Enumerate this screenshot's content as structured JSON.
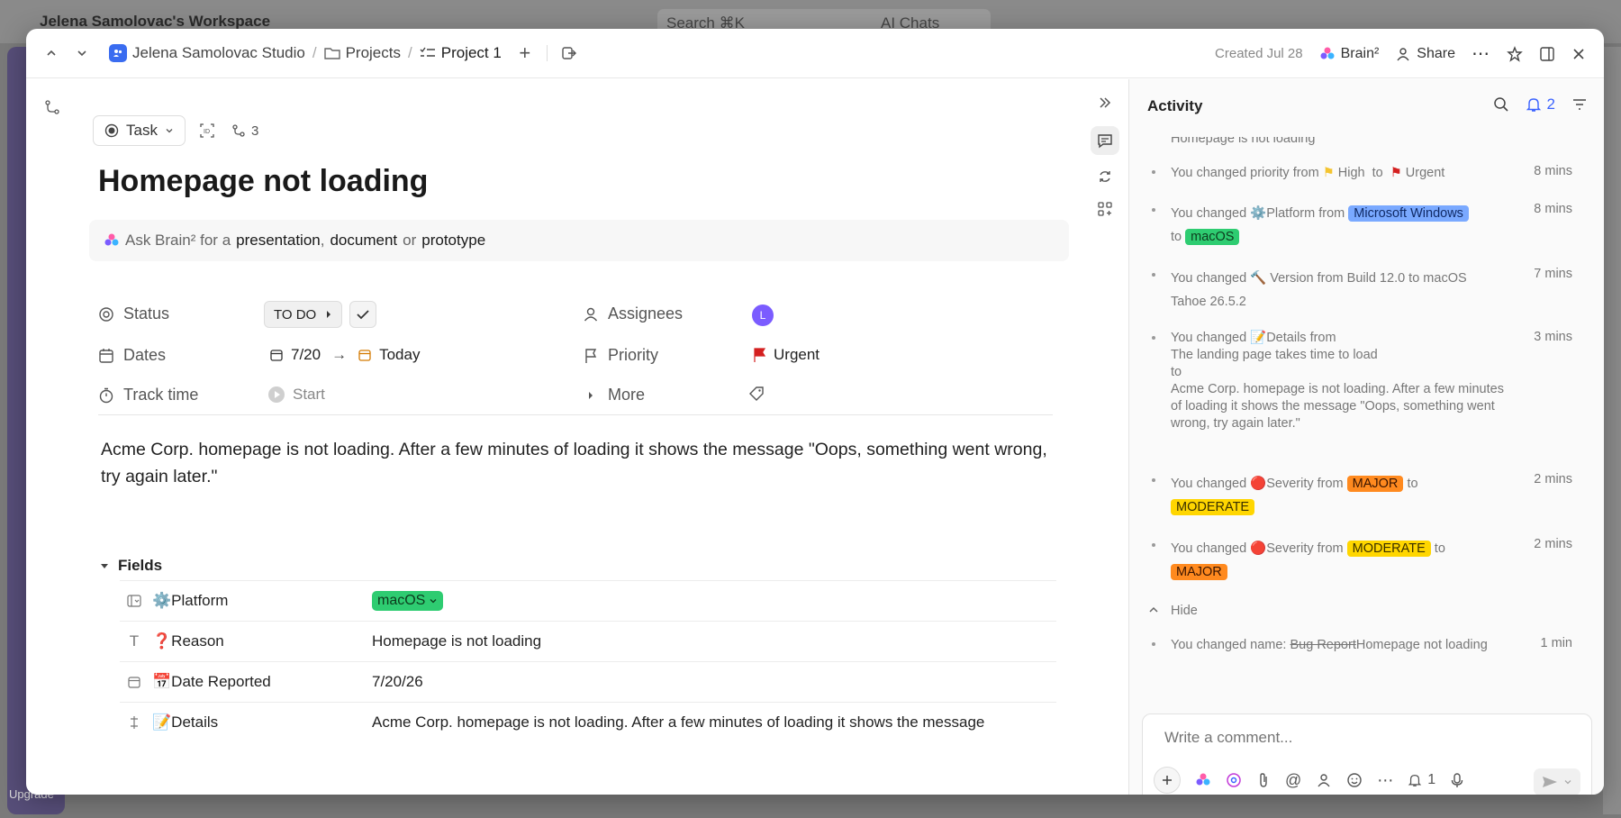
{
  "background": {
    "workspace_name": "Jelena Samolovac's Workspace",
    "search_placeholder": "Search ⌘K",
    "ai_chats": "AI Chats",
    "upgrade": "Upgrade"
  },
  "header": {
    "breadcrumbs": [
      "Jelena Samolovac Studio",
      "Projects",
      "Project 1"
    ],
    "created": "Created Jul 28",
    "brain": "Brain²",
    "share": "Share"
  },
  "task": {
    "type_label": "Task",
    "subtask_count": "3",
    "title": "Homepage not loading",
    "ask_prefix": "Ask Brain² for a",
    "ask_opt1": "presentation",
    "ask_comma": ",",
    "ask_opt2": "document",
    "ask_or": "or",
    "ask_opt3": "prototype"
  },
  "props": {
    "status_label": "Status",
    "status_value": "TO DO",
    "dates_label": "Dates",
    "start_date": "7/20",
    "due_date": "Today",
    "track_label": "Track time",
    "track_value": "Start",
    "assignees_label": "Assignees",
    "assignee_initial": "L",
    "priority_label": "Priority",
    "priority_value": "Urgent",
    "more_label": "More"
  },
  "description": "Acme Corp. homepage is not loading. After a few minutes of loading it shows the message \"Oops, something went wrong, try again later.\"",
  "fields": {
    "heading": "Fields",
    "rows": [
      {
        "label": "⚙️Platform",
        "value": "macOS"
      },
      {
        "label": "❓Reason",
        "value": "Homepage is not loading"
      },
      {
        "label": "📅Date Reported",
        "value": "7/20/26"
      },
      {
        "label": "📝Details",
        "value": "Acme Corp. homepage is not loading. After a few minutes of loading it shows the message"
      }
    ]
  },
  "activity": {
    "title": "Activity",
    "notif_count": "2",
    "partial_top": "Homepage is not loading",
    "i1": {
      "a": "You changed priority from",
      "b": "High",
      "c": "to",
      "d": "Urgent",
      "time": "8 mins"
    },
    "i2": {
      "a": "You changed ⚙️Platform from",
      "b": "Microsoft Windows",
      "c": "to",
      "d": "macOS",
      "time": "8 mins"
    },
    "i3": {
      "a": "You changed 🔨 Version from Build 12.0 to macOS Tahoe 26.5.2",
      "time": "7 mins"
    },
    "i4": {
      "a": "You changed 📝Details from",
      "b": "The landing page takes time to load",
      "c": "to",
      "d": "Acme Corp. homepage is not loading. After a few minutes of loading it shows the message \"Oops, something went wrong, try again later.\"",
      "time": "3 mins"
    },
    "i5": {
      "a": "You changed 🔴Severity from",
      "b": "MAJOR",
      "c": "to",
      "d": "MODERATE",
      "time": "2 mins"
    },
    "i6": {
      "a": "You changed 🔴Severity from",
      "b": "MODERATE",
      "c": "to",
      "d": "MAJOR",
      "time": "2 mins"
    },
    "hide": "Hide",
    "i7": {
      "a": "You changed name:",
      "b": "Bug Report",
      "c": "Homepage not loading",
      "time": "1 min"
    }
  },
  "comment": {
    "placeholder": "Write a comment...",
    "notify_count": "1"
  },
  "colors": {
    "accent": "#7b5cff",
    "tag_green": "#2ecc71",
    "tag_blue": "#7aa9ff",
    "tag_orange": "#ff8a1f",
    "tag_yellow": "#ffd600",
    "urgent_red": "#d42020"
  }
}
